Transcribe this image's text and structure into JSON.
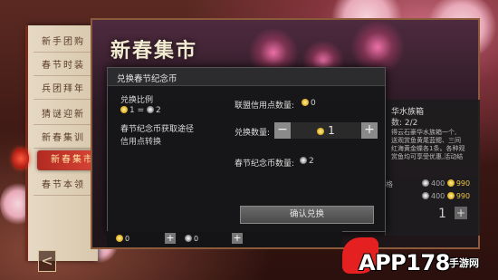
{
  "event": {
    "title": "新春集市"
  },
  "menu": {
    "items": [
      {
        "label": "新手团购"
      },
      {
        "label": "春节时装"
      },
      {
        "label": "兵团拜年"
      },
      {
        "label": "猜谜迎新"
      },
      {
        "label": "新春集训"
      },
      {
        "label": "新春集市"
      },
      {
        "label": "春节本领"
      }
    ],
    "active_index": 5,
    "back_label": "<"
  },
  "dialog": {
    "title": "兑换春节纪念币",
    "ratio_label": "兑换比例",
    "ratio_gold": "1",
    "ratio_eq": "=",
    "ratio_silver": "2",
    "source_label": "春节纪念币获取途径",
    "source_value": "信用点转换",
    "credit_label": "联盟信用点数量:",
    "credit_value": "0",
    "exchange_label": "兑换数量:",
    "exchange_value": "1",
    "minus": "−",
    "plus": "+",
    "coin_label": "春节纪念币数量:",
    "coin_value": "2",
    "confirm_label": "确认兑换"
  },
  "right_panel": {
    "title": "华水族箱",
    "progress": "数: 2/2",
    "desc_lines": [
      "得云石豪华水族箱一个,",
      "送观赏鱼黄尾蓝鳃、三间",
      "红海黄金蝶各1条。各种观",
      "赏鱼均可享受优惠,活动结"
    ],
    "price_label": "格",
    "price_rows": [
      {
        "silver": "400",
        "gold": "990"
      },
      {
        "silver": "400",
        "gold": "990"
      }
    ],
    "qty": "1",
    "plus": "+"
  },
  "currency_bar": {
    "gold_value": "0",
    "silver_value": "0",
    "plus": "+"
  },
  "watermark": {
    "text": "APP178",
    "sub": "手游网"
  },
  "colors": {
    "active_menu": "#d0392b",
    "gold_coin": "#e2b52a",
    "dialog_bg": "#161618"
  }
}
